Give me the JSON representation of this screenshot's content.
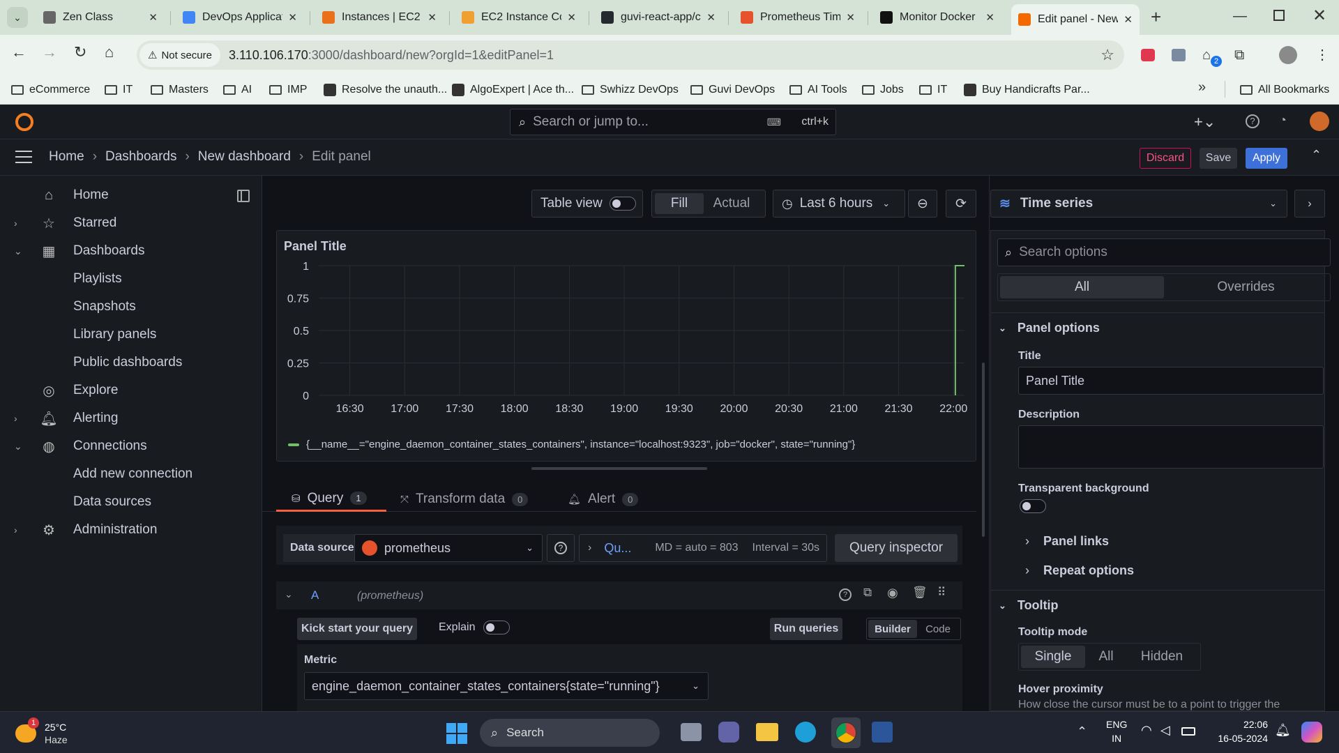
{
  "browser": {
    "tabs": [
      {
        "title": "Zen Class",
        "favicon_color": "#666666"
      },
      {
        "title": "DevOps Applicat",
        "favicon_color": "#4285f4"
      },
      {
        "title": "Instances | EC2 |",
        "favicon_color": "#e8711a"
      },
      {
        "title": "EC2 Instance Co",
        "favicon_color": "#f0a030"
      },
      {
        "title": "guvi-react-app/c",
        "favicon_color": "#24292f"
      },
      {
        "title": "Prometheus Tim",
        "favicon_color": "#e6522c"
      },
      {
        "title": "Monitor Docker",
        "favicon_color": "#111111"
      },
      {
        "title": "Edit panel - New",
        "favicon_color": "#f46800"
      }
    ],
    "security_label": "Not secure",
    "url_host": "3.110.106.170",
    "url_rest": ":3000/dashboard/new?orgId=1&editPanel=1",
    "extension_badge": "2",
    "bookmarks": [
      {
        "label": "eCommerce",
        "type": "folder"
      },
      {
        "label": "IT",
        "type": "folder"
      },
      {
        "label": "Masters",
        "type": "folder"
      },
      {
        "label": "AI",
        "type": "folder"
      },
      {
        "label": "IMP",
        "type": "folder"
      },
      {
        "label": "Resolve the unauth...",
        "type": "site"
      },
      {
        "label": "AlgoExpert | Ace th...",
        "type": "site"
      },
      {
        "label": "Swhizz DevOps",
        "type": "folder"
      },
      {
        "label": "Guvi DevOps",
        "type": "folder"
      },
      {
        "label": "AI Tools",
        "type": "folder"
      },
      {
        "label": "Jobs",
        "type": "folder"
      },
      {
        "label": "IT",
        "type": "folder"
      },
      {
        "label": "Buy Handicrafts Par...",
        "type": "site"
      }
    ],
    "all_bookmarks": "All Bookmarks"
  },
  "grafana": {
    "search_placeholder": "Search or jump to...",
    "search_shortcut": "ctrl+k",
    "breadcrumb": [
      "Home",
      "Dashboards",
      "New dashboard",
      "Edit panel"
    ],
    "discard": "Discard",
    "save": "Save",
    "apply": "Apply",
    "sidebar": [
      {
        "label": "Home",
        "icon": "home-icon",
        "chevron": ""
      },
      {
        "label": "Starred",
        "icon": "star-icon",
        "chevron": "›"
      },
      {
        "label": "Dashboards",
        "icon": "apps-icon",
        "chevron": "⌄"
      },
      {
        "label": "Playlists",
        "icon": "",
        "chevron": ""
      },
      {
        "label": "Snapshots",
        "icon": "",
        "chevron": ""
      },
      {
        "label": "Library panels",
        "icon": "",
        "chevron": ""
      },
      {
        "label": "Public dashboards",
        "icon": "",
        "chevron": ""
      },
      {
        "label": "Explore",
        "icon": "compass-icon",
        "chevron": ""
      },
      {
        "label": "Alerting",
        "icon": "bell-icon",
        "chevron": "›"
      },
      {
        "label": "Connections",
        "icon": "connections-icon",
        "chevron": "⌄"
      },
      {
        "label": "Add new connection",
        "icon": "",
        "chevron": ""
      },
      {
        "label": "Data sources",
        "icon": "",
        "chevron": ""
      },
      {
        "label": "Administration",
        "icon": "cog-icon",
        "chevron": "›"
      }
    ],
    "toolbar": {
      "table_view": "Table view",
      "fill": "Fill",
      "actual": "Actual",
      "time_range": "Last 6 hours"
    },
    "panel": {
      "title": "Panel Title"
    },
    "tabs": [
      {
        "label": "Query",
        "count": "1"
      },
      {
        "label": "Transform data",
        "count": "0"
      },
      {
        "label": "Alert",
        "count": "0"
      }
    ],
    "query": {
      "data_source_label": "Data source",
      "data_source": "prometheus",
      "options_short": "Qu...",
      "md": "MD = auto = 803",
      "interval": "Interval = 30s",
      "inspector": "Query inspector",
      "ref_id": "A",
      "ref_ds": "(prometheus)",
      "kick_start": "Kick start your query",
      "explain": "Explain",
      "run": "Run queries",
      "builder": "Builder",
      "code": "Code",
      "metric_label": "Metric",
      "metric_value": "engine_daemon_container_states_containers{state=\"running\"}"
    },
    "options": {
      "viz": "Time series",
      "search_placeholder": "Search options",
      "all": "All",
      "overrides": "Overrides",
      "panel_options": "Panel options",
      "title_label": "Title",
      "title_value": "Panel Title",
      "description_label": "Description",
      "transparent_label": "Transparent background",
      "panel_links": "Panel links",
      "repeat_options": "Repeat options",
      "tooltip": "Tooltip",
      "tooltip_mode_label": "Tooltip mode",
      "tooltip_modes": [
        "Single",
        "All",
        "Hidden"
      ],
      "hover_label": "Hover proximity",
      "hover_desc": "How close the cursor must be to a point to trigger the"
    }
  },
  "chart_data": {
    "type": "line",
    "title": "Panel Title",
    "x_ticks": [
      "16:30",
      "17:00",
      "17:30",
      "18:00",
      "18:30",
      "19:00",
      "19:30",
      "20:00",
      "20:30",
      "21:00",
      "21:30",
      "22:00"
    ],
    "y_ticks": [
      "1",
      "0.75",
      "0.5",
      "0.25",
      "0"
    ],
    "ylim": [
      0,
      1
    ],
    "x_range": [
      "16:13",
      "22:06"
    ],
    "series": [
      {
        "name": "{__name__=\"engine_daemon_container_states_containers\", instance=\"localhost:9323\", job=\"docker\", state=\"running\"}",
        "color": "#73bf69",
        "x": [
          "22:01",
          "22:01",
          "22:06"
        ],
        "values": [
          0,
          1,
          1
        ]
      }
    ],
    "grid": true,
    "legend": "bottom"
  },
  "taskbar": {
    "weather_temp": "25°C",
    "weather_desc": "Haze",
    "weather_badge": "1",
    "search": "Search",
    "lang1": "ENG",
    "lang2": "IN",
    "time": "22:06",
    "date": "16-05-2024"
  }
}
